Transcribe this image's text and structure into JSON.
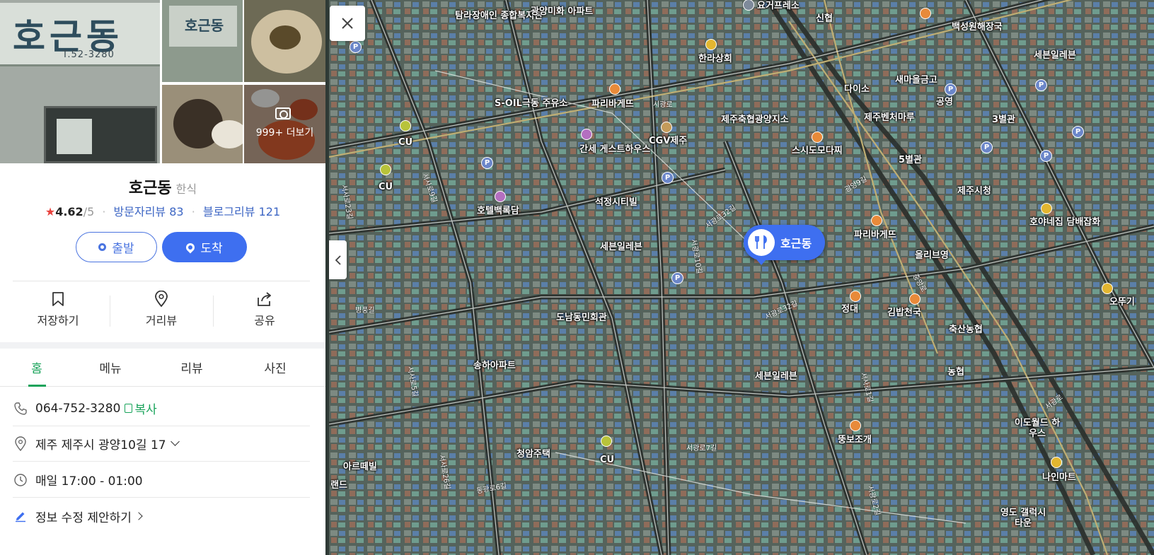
{
  "photos": {
    "sign_text": "호근동",
    "sign_sub": "T.52-3280",
    "mini_sign_text": "호근동",
    "more_label": "999+ 더보기"
  },
  "place": {
    "name": "호근동",
    "category": "한식",
    "rating": "4.62",
    "rating_max": "/5",
    "visitor_reviews_label": "방문자리뷰",
    "visitor_reviews_count": "83",
    "blog_reviews_label": "블로그리뷰",
    "blog_reviews_count": "121"
  },
  "buttons": {
    "start": "출발",
    "arrive": "도착"
  },
  "actions": [
    {
      "label": "저장하기",
      "icon": "bookmark-icon"
    },
    {
      "label": "거리뷰",
      "icon": "location-pin-icon"
    },
    {
      "label": "공유",
      "icon": "share-icon"
    }
  ],
  "tabs": [
    "홈",
    "메뉴",
    "리뷰",
    "사진"
  ],
  "active_tab": "홈",
  "info": {
    "phone": "064-752-3280",
    "copy_label": "복사",
    "address": "제주 제주시 광양10길 17",
    "hours": "매일 17:00 - 01:00",
    "suggest_edit": "정보 수정 제안하기"
  },
  "map": {
    "marker_label": "호근동",
    "labels": [
      "탐라장애인 종합복지관",
      "광양미화 아파트",
      "요거프레소",
      "신협",
      "백성원해장국",
      "세븐일레븐",
      "한라상회",
      "다이소",
      "새마을금고",
      "공영",
      "S-OIL극동 주유소",
      "파리바게뜨",
      "제주축협광양지소",
      "제주벤처마루",
      "3별관",
      "CU",
      "CU",
      "간세 게스트하우스",
      "CGV제주",
      "스시도모다찌",
      "5별관",
      "호텔백록담",
      "석정시티빌",
      "제주시청",
      "호야네집 담배잡화",
      "세븐일레븐",
      "파리바게뜨",
      "올리브영",
      "도남동민회관",
      "정대",
      "김밥천국",
      "오뚜기",
      "축산농협",
      "송하아파트",
      "세븐일레븐",
      "농협",
      "청암주택",
      "CU",
      "뚱보조개",
      "아르떼빌",
      "랜드",
      "이도월드 하우스",
      "나인마트",
      "영도 갤럭시타운"
    ],
    "road_labels": [
      "시광로",
      "광양9길",
      "서광로32길",
      "서광로32길",
      "서사로9길",
      "서사로5길",
      "서사로23길",
      "서광로10길",
      "병풍길",
      "서사로26길",
      "서광로7길",
      "서사로1길",
      "서광로2길",
      "중앙로",
      "동광로6길",
      "서광로"
    ]
  },
  "colors": {
    "brand_blue": "#3e6ff0",
    "green": "#18a35a",
    "star_red": "#e8413c"
  }
}
